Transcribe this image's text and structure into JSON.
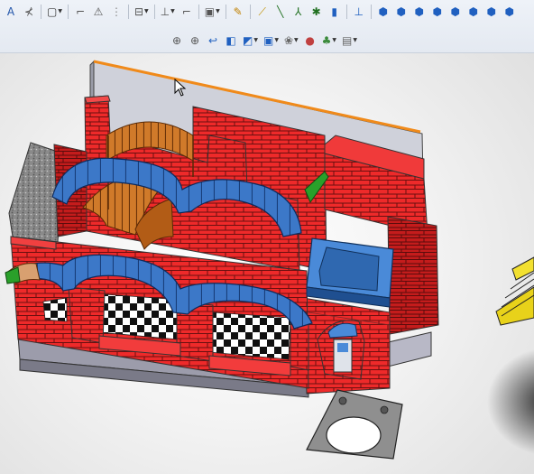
{
  "toolbar": {
    "row1": [
      {
        "name": "sketch-text-icon",
        "glyph": "A",
        "color": "#2255aa"
      },
      {
        "name": "mirror-entities-icon",
        "glyph": "⊀",
        "color": "#555"
      },
      {
        "sep": true
      },
      {
        "name": "offset-entities-icon",
        "glyph": "▢",
        "color": "#333",
        "dd": true
      },
      {
        "sep": true
      },
      {
        "name": "convert-entities-icon",
        "glyph": "⌐",
        "color": "#555"
      },
      {
        "name": "relations-icon",
        "glyph": "⚠",
        "color": "#555"
      },
      {
        "name": "grid-snap-icon",
        "glyph": "⋮",
        "color": "#888"
      },
      {
        "sep": true
      },
      {
        "name": "dimension-icon",
        "glyph": "⊟",
        "color": "#555",
        "dd": true
      },
      {
        "sep": true
      },
      {
        "name": "move-entities-icon",
        "glyph": "⊥",
        "color": "#555",
        "dd": true
      },
      {
        "name": "rotate-entities-icon",
        "glyph": "⌐",
        "color": "#555"
      },
      {
        "sep": true
      },
      {
        "name": "rapid-sketch-icon",
        "glyph": "▣",
        "color": "#555",
        "dd": true
      },
      {
        "sep": true
      },
      {
        "name": "instant-2d-icon",
        "glyph": "✎",
        "color": "#c08000"
      },
      {
        "sep": true
      },
      {
        "name": "weld-bead-icon",
        "glyph": "⟋",
        "color": "#c09000"
      },
      {
        "name": "line-icon",
        "glyph": "╲",
        "color": "#207020"
      },
      {
        "name": "spline-icon",
        "glyph": "⅄",
        "color": "#207020"
      },
      {
        "name": "point-icon",
        "glyph": "✱",
        "color": "#207020"
      },
      {
        "name": "plane-icon",
        "glyph": "▮",
        "color": "#2060c0"
      },
      {
        "sep": true
      },
      {
        "name": "coordinate-system-icon",
        "glyph": "⊥",
        "color": "#2060c0"
      },
      {
        "sep": true
      },
      {
        "name": "view-front-icon",
        "glyph": "⬢",
        "color": "#2060c0"
      },
      {
        "name": "view-back-icon",
        "glyph": "⬢",
        "color": "#2060c0"
      },
      {
        "name": "view-left-icon",
        "glyph": "⬢",
        "color": "#2060c0"
      },
      {
        "name": "view-right-icon",
        "glyph": "⬢",
        "color": "#2060c0"
      },
      {
        "name": "view-top-icon",
        "glyph": "⬢",
        "color": "#2060c0"
      },
      {
        "name": "view-bottom-icon",
        "glyph": "⬢",
        "color": "#2060c0"
      },
      {
        "name": "view-isometric-icon",
        "glyph": "⬢",
        "color": "#2060c0"
      },
      {
        "name": "view-trimetric-icon",
        "glyph": "⬢",
        "color": "#2060c0"
      }
    ],
    "row2": [
      {
        "name": "zoom-to-fit-icon",
        "glyph": "⊕",
        "color": "#555"
      },
      {
        "name": "zoom-to-area-icon",
        "glyph": "⊕",
        "color": "#555"
      },
      {
        "name": "previous-view-icon",
        "glyph": "↩",
        "color": "#2060c0"
      },
      {
        "name": "section-view-icon",
        "glyph": "◧",
        "color": "#2060c0"
      },
      {
        "name": "view-orientation-icon",
        "glyph": "◩",
        "color": "#2060c0",
        "dd": true
      },
      {
        "name": "display-style-icon",
        "glyph": "▣",
        "color": "#2060c0",
        "dd": true
      },
      {
        "name": "hide-show-items-icon",
        "glyph": "❀",
        "color": "#666",
        "dd": true
      },
      {
        "name": "edit-appearance-icon",
        "glyph": "●",
        "color": "#c04040"
      },
      {
        "name": "apply-scene-icon",
        "glyph": "♣",
        "color": "#3a8a3a",
        "dd": true
      },
      {
        "name": "view-settings-icon",
        "glyph": "▤",
        "color": "#666",
        "dd": true
      }
    ]
  }
}
